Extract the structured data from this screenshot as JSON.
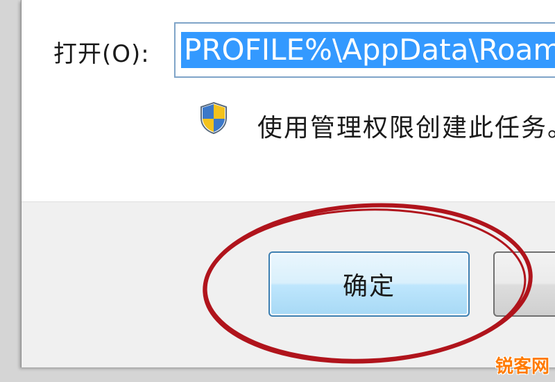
{
  "run_dialog": {
    "open_label": "打开(O):",
    "open_value": "PROFILE%\\AppData\\Roamin",
    "admin_note": "使用管理权限创建此任务。",
    "ok_label": "确定"
  },
  "icons": {
    "shield": "uac-shield-icon"
  },
  "colors": {
    "selection": "#3399ff",
    "annotation": "#b0141c",
    "button_border": "#3c7fb1"
  },
  "watermark": {
    "text": "锐客网"
  }
}
